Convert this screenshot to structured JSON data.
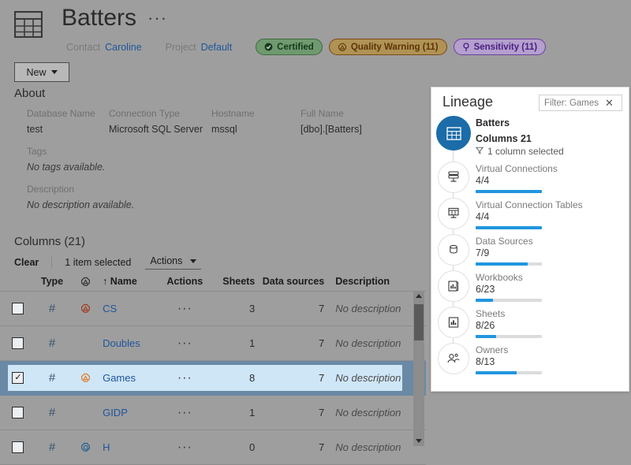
{
  "header": {
    "table_icon": "table-icon",
    "title": "Batters",
    "more_label": "···",
    "contact_label": "Contact",
    "contact_value": "Caroline",
    "project_label": "Project",
    "project_value": "Default",
    "badges": [
      {
        "key": "certified",
        "icon": "certified-icon",
        "label": "Certified"
      },
      {
        "key": "quality",
        "icon": "quality-warning-icon",
        "label": "Quality Warning (11)"
      },
      {
        "key": "sensitivity",
        "icon": "sensitivity-icon",
        "label": "Sensitivity (11)"
      }
    ],
    "new_button": "New"
  },
  "about": {
    "heading": "About",
    "fields": [
      {
        "label": "Database Name",
        "value": "test"
      },
      {
        "label": "Connection Type",
        "value": "Microsoft SQL Server"
      },
      {
        "label": "Hostname",
        "value": "mssql"
      },
      {
        "label": "Full Name",
        "value": "[dbo].[Batters]"
      }
    ],
    "tags_label": "Tags",
    "tags_value": "No tags available.",
    "description_label": "Description",
    "description_value": "No description available."
  },
  "columns_section": {
    "heading": "Columns (21)",
    "clear_label": "Clear",
    "selected_label": "1 item selected",
    "actions_label": "Actions",
    "headers": {
      "type": "Type",
      "quality": "quality-warning-icon",
      "name": "↑ Name",
      "actions": "Actions",
      "sheets": "Sheets",
      "data_sources": "Data sources",
      "description": "Description"
    },
    "rows": [
      {
        "checked": false,
        "type": "#",
        "warn": "quality-warning-red",
        "name": "CS",
        "actions": "···",
        "sheets": "3",
        "data_sources": "7",
        "description": "No description"
      },
      {
        "checked": false,
        "type": "#",
        "warn": "none",
        "name": "Doubles",
        "actions": "···",
        "sheets": "1",
        "data_sources": "7",
        "description": "No description"
      },
      {
        "checked": true,
        "type": "#",
        "warn": "quality-warning-orange",
        "name": "Games",
        "actions": "···",
        "sheets": "8",
        "data_sources": "7",
        "description": "No description"
      },
      {
        "checked": false,
        "type": "#",
        "warn": "none",
        "name": "GIDP",
        "actions": "···",
        "sheets": "1",
        "data_sources": "7",
        "description": "No description"
      },
      {
        "checked": false,
        "type": "#",
        "warn": "sensitivity-blue",
        "name": "H",
        "actions": "···",
        "sheets": "0",
        "data_sources": "7",
        "description": "No description"
      }
    ]
  },
  "lineage": {
    "title": "Lineage",
    "filter_label": "Filter: Games",
    "filter_close": "✕",
    "root": {
      "icon": "table-icon",
      "name": "Batters",
      "columns_label": "Columns 21",
      "selection_label": "1 column selected"
    },
    "nodes": [
      {
        "icon": "virtual-connection-icon",
        "label": "Virtual Connections",
        "count": "4/4",
        "pct": 100
      },
      {
        "icon": "virtual-connection-table-icon",
        "label": "Virtual Connection Tables",
        "count": "4/4",
        "pct": 100
      },
      {
        "icon": "data-source-icon",
        "label": "Data Sources",
        "count": "7/9",
        "pct": 78
      },
      {
        "icon": "workbook-icon",
        "label": "Workbooks",
        "count": "6/23",
        "pct": 26
      },
      {
        "icon": "sheet-icon",
        "label": "Sheets",
        "count": "8/26",
        "pct": 31
      },
      {
        "icon": "owners-icon",
        "label": "Owners",
        "count": "8/13",
        "pct": 62
      }
    ]
  },
  "colors": {
    "background": "#9e9e9e",
    "panel": "#ffffff",
    "link": "#20559b",
    "accent_blue": "#1b6ca8",
    "bar_blue": "#2196de",
    "selected_row": "#6a89a5",
    "selected_row_inner": "#cfe6f7",
    "certified": "#6f9a6f",
    "quality_warning": "#b09255",
    "sensitivity": "#b49fce"
  }
}
